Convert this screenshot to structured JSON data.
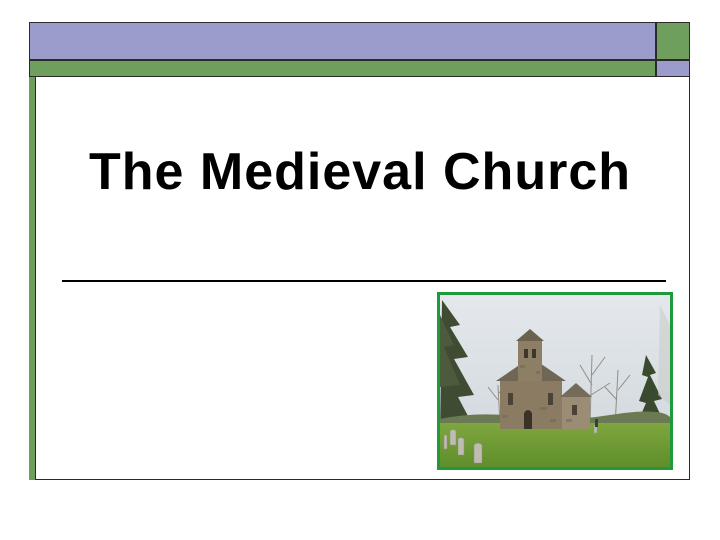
{
  "slide": {
    "title": "The Medieval Church"
  },
  "colors": {
    "band_purple": "#9b9bcc",
    "band_green": "#6f9f5c",
    "photo_border": "#1f9a3a"
  }
}
